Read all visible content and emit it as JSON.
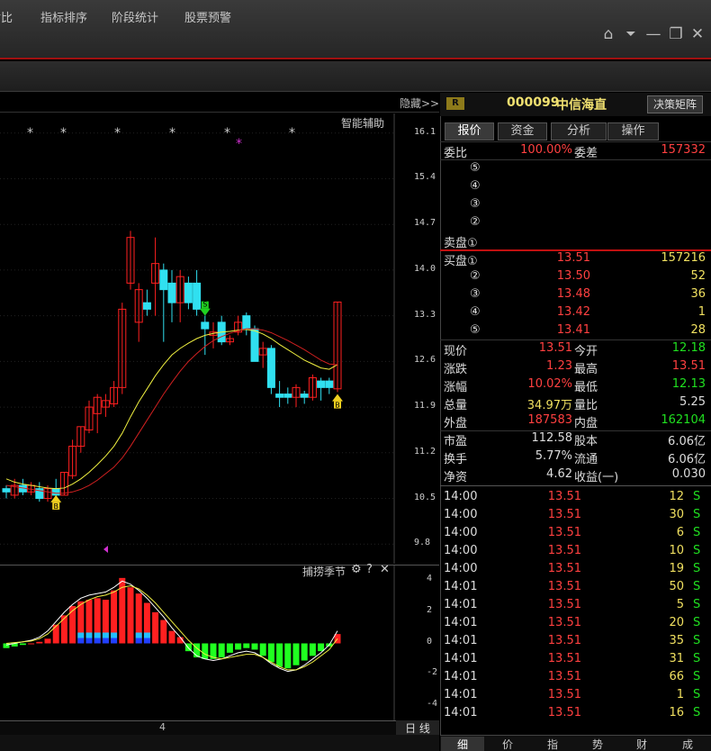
{
  "window_controls": {
    "home": "⌂",
    "dropdown": "⏷",
    "minimize": "—",
    "restore": "❐",
    "close": "✕"
  },
  "menu": [
    "对比",
    "指标排序",
    "阶段统计",
    "股票预警"
  ],
  "chart": {
    "hide_label": "隐藏>>",
    "assist_label": "智能辅助",
    "y_labels": [
      "16.1",
      "15.4",
      "14.7",
      "14.0",
      "13.3",
      "12.6",
      "11.9",
      "11.2",
      "10.5",
      "9.8"
    ],
    "sub_label": "捕捞季节",
    "sub_icons": {
      "gear": "⚙",
      "help": "?",
      "close": "✕"
    },
    "sub_y_labels": [
      "4",
      "2",
      "0",
      "-2",
      "-4"
    ],
    "x_label": "4",
    "period_button": "日 线",
    "buy_marker": "B",
    "sell_marker": "S"
  },
  "chart_data": {
    "type": "candlestick",
    "ylim": [
      9.5,
      16.4
    ],
    "candles": [
      {
        "o": 10.6,
        "h": 10.7,
        "l": 10.5,
        "c": 10.65,
        "up": false
      },
      {
        "o": 10.55,
        "h": 10.8,
        "l": 10.5,
        "c": 10.7,
        "up": true
      },
      {
        "o": 10.7,
        "h": 10.8,
        "l": 10.55,
        "c": 10.6,
        "up": false
      },
      {
        "o": 10.6,
        "h": 10.75,
        "l": 10.55,
        "c": 10.7,
        "up": true
      },
      {
        "o": 10.65,
        "h": 10.75,
        "l": 10.45,
        "c": 10.5,
        "up": false
      },
      {
        "o": 10.5,
        "h": 10.7,
        "l": 10.45,
        "c": 10.65,
        "up": true
      },
      {
        "o": 10.65,
        "h": 10.8,
        "l": 10.5,
        "c": 10.55,
        "up": false
      },
      {
        "o": 10.55,
        "h": 10.9,
        "l": 10.55,
        "c": 10.9,
        "up": true
      },
      {
        "o": 10.85,
        "h": 11.4,
        "l": 10.8,
        "c": 11.3,
        "up": true
      },
      {
        "o": 11.3,
        "h": 11.6,
        "l": 11.2,
        "c": 11.6,
        "up": true
      },
      {
        "o": 11.55,
        "h": 12.0,
        "l": 11.5,
        "c": 11.9,
        "up": true
      },
      {
        "o": 11.8,
        "h": 12.1,
        "l": 11.5,
        "c": 12.05,
        "up": true
      },
      {
        "o": 11.9,
        "h": 12.1,
        "l": 11.75,
        "c": 12.0,
        "up": true
      },
      {
        "o": 11.95,
        "h": 12.3,
        "l": 11.9,
        "c": 12.2,
        "up": true
      },
      {
        "o": 12.2,
        "h": 13.5,
        "l": 12.1,
        "c": 13.4,
        "up": true
      },
      {
        "o": 13.8,
        "h": 14.6,
        "l": 13.7,
        "c": 14.5,
        "up": true
      },
      {
        "o": 13.2,
        "h": 13.8,
        "l": 12.9,
        "c": 13.7,
        "up": true
      },
      {
        "o": 13.5,
        "h": 13.7,
        "l": 13.3,
        "c": 13.4,
        "up": false
      },
      {
        "o": 13.8,
        "h": 14.5,
        "l": 13.3,
        "c": 14.1,
        "up": true
      },
      {
        "o": 14.0,
        "h": 14.1,
        "l": 12.9,
        "c": 13.7,
        "up": false
      },
      {
        "o": 13.8,
        "h": 14.0,
        "l": 13.2,
        "c": 13.5,
        "up": false
      },
      {
        "o": 13.9,
        "h": 14.0,
        "l": 13.2,
        "c": 13.5,
        "up": true
      },
      {
        "o": 13.8,
        "h": 13.9,
        "l": 13.4,
        "c": 13.5,
        "up": false
      },
      {
        "o": 13.8,
        "h": 14.0,
        "l": 13.3,
        "c": 13.4,
        "up": false
      },
      {
        "o": 13.2,
        "h": 13.3,
        "l": 12.7,
        "c": 13.1,
        "up": false
      },
      {
        "o": 13.0,
        "h": 13.2,
        "l": 12.8,
        "c": 13.05,
        "up": true
      },
      {
        "o": 13.2,
        "h": 13.3,
        "l": 12.85,
        "c": 12.9,
        "up": false
      },
      {
        "o": 12.9,
        "h": 13.0,
        "l": 12.85,
        "c": 12.95,
        "up": true
      },
      {
        "o": 13.05,
        "h": 13.3,
        "l": 13.0,
        "c": 13.2,
        "up": true
      },
      {
        "o": 13.3,
        "h": 13.35,
        "l": 13.0,
        "c": 13.1,
        "up": false
      },
      {
        "o": 13.1,
        "h": 13.15,
        "l": 12.6,
        "c": 12.6,
        "up": false
      },
      {
        "o": 12.7,
        "h": 12.9,
        "l": 12.5,
        "c": 12.8,
        "up": true
      },
      {
        "o": 12.8,
        "h": 12.85,
        "l": 12.1,
        "c": 12.2,
        "up": false
      },
      {
        "o": 12.1,
        "h": 12.3,
        "l": 11.9,
        "c": 12.05,
        "up": false
      },
      {
        "o": 12.1,
        "h": 12.2,
        "l": 11.95,
        "c": 12.05,
        "up": false
      },
      {
        "o": 12.05,
        "h": 12.25,
        "l": 11.9,
        "c": 12.2,
        "up": true
      },
      {
        "o": 12.1,
        "h": 12.15,
        "l": 11.95,
        "c": 12.05,
        "up": false
      },
      {
        "o": 12.05,
        "h": 12.4,
        "l": 12.0,
        "c": 12.35,
        "up": true
      },
      {
        "o": 12.3,
        "h": 12.35,
        "l": 12.0,
        "c": 12.2,
        "up": false
      },
      {
        "o": 12.2,
        "h": 12.35,
        "l": 12.1,
        "c": 12.3,
        "up": false
      },
      {
        "o": 12.18,
        "h": 13.51,
        "l": 12.13,
        "c": 13.51,
        "up": true
      }
    ],
    "ma_yellow": [
      10.8,
      10.75,
      10.72,
      10.7,
      10.68,
      10.66,
      10.65,
      10.66,
      10.72,
      10.8,
      10.9,
      11.02,
      11.15,
      11.3,
      11.5,
      11.75,
      11.98,
      12.18,
      12.38,
      12.55,
      12.7,
      12.8,
      12.88,
      12.95,
      13.0,
      13.03,
      13.05,
      13.06,
      13.08,
      13.09,
      13.07,
      13.02,
      12.95,
      12.86,
      12.78,
      12.7,
      12.62,
      12.56,
      12.5,
      12.48,
      12.55
    ],
    "ma_red": [
      10.7,
      10.68,
      10.66,
      10.64,
      10.62,
      10.6,
      10.58,
      10.58,
      10.6,
      10.64,
      10.7,
      10.78,
      10.88,
      10.98,
      11.12,
      11.3,
      11.5,
      11.7,
      11.9,
      12.1,
      12.28,
      12.45,
      12.6,
      12.72,
      12.83,
      12.92,
      12.98,
      13.03,
      13.07,
      13.1,
      13.1,
      13.08,
      13.04,
      12.98,
      12.92,
      12.85,
      12.78,
      12.7,
      12.62,
      12.56,
      12.55
    ],
    "macd_hist": [
      -0.3,
      -0.2,
      -0.1,
      0,
      0.1,
      0.3,
      1.2,
      1.8,
      2.4,
      2.7,
      2.8,
      2.9,
      2.8,
      3.4,
      4.2,
      3.6,
      3.2,
      2.6,
      2.0,
      1.5,
      0.8,
      0.4,
      -0.5,
      -0.9,
      -1.0,
      -1.0,
      -0.9,
      -0.6,
      -0.4,
      -0.3,
      -0.4,
      -0.8,
      -1.2,
      -1.5,
      -1.6,
      -1.4,
      -1.1,
      -0.8,
      -0.5,
      -0.2,
      0.6
    ],
    "macd_dif": [
      -0.1,
      0,
      0.1,
      0.2,
      0.4,
      0.8,
      1.4,
      2.0,
      2.5,
      2.9,
      3.1,
      3.2,
      3.3,
      3.6,
      4.0,
      3.8,
      3.4,
      2.9,
      2.3,
      1.7,
      1.0,
      0.4,
      -0.3,
      -0.8,
      -1.0,
      -1.1,
      -1.0,
      -0.8,
      -0.6,
      -0.5,
      -0.6,
      -0.9,
      -1.3,
      -1.6,
      -1.8,
      -1.7,
      -1.4,
      -1.0,
      -0.6,
      -0.1,
      0.8
    ],
    "macd_dea": [
      0,
      0.05,
      0.1,
      0.15,
      0.3,
      0.6,
      1.1,
      1.6,
      2.1,
      2.5,
      2.8,
      3.0,
      3.1,
      3.3,
      3.6,
      3.7,
      3.5,
      3.1,
      2.6,
      2.0,
      1.4,
      0.8,
      0.2,
      -0.3,
      -0.7,
      -0.9,
      -1.0,
      -0.9,
      -0.8,
      -0.7,
      -0.7,
      -0.9,
      -1.2,
      -1.5,
      -1.7,
      -1.7,
      -1.5,
      -1.2,
      -0.8,
      -0.4,
      0.3
    ],
    "sublim": [
      -5,
      5
    ]
  },
  "stock": {
    "badge": "R",
    "code": "000099",
    "name": "中信海直",
    "decision_button": "决策矩阵"
  },
  "tabs": [
    "报价",
    "资金",
    "分析",
    "操作"
  ],
  "order_book": {
    "wei_bi_label": "委比",
    "wei_bi": "100.00%",
    "wei_cha_label": "委差",
    "wei_cha": "157332",
    "sell_labels": [
      "⑤",
      "④",
      "③",
      "②",
      "卖盘①"
    ],
    "buy": [
      {
        "label": "买盘①",
        "price": "13.51",
        "vol": "157216"
      },
      {
        "label": "②",
        "price": "13.50",
        "vol": "52"
      },
      {
        "label": "③",
        "price": "13.48",
        "vol": "36"
      },
      {
        "label": "④",
        "price": "13.42",
        "vol": "1"
      },
      {
        "label": "⑤",
        "price": "13.41",
        "vol": "28"
      }
    ]
  },
  "quote": [
    {
      "l1": "现价",
      "v1": "13.51",
      "c1": "red",
      "l2": "今开",
      "v2": "12.18",
      "c2": "green"
    },
    {
      "l1": "涨跌",
      "v1": "1.23",
      "c1": "red",
      "l2": "最高",
      "v2": "13.51",
      "c2": "red"
    },
    {
      "l1": "涨幅",
      "v1": "10.02%",
      "c1": "red",
      "l2": "最低",
      "v2": "12.13",
      "c2": "green"
    },
    {
      "l1": "总量",
      "v1": "34.97万",
      "c1": "yellow",
      "l2": "量比",
      "v2": "5.25",
      "c2": "white"
    },
    {
      "l1": "外盘",
      "v1": "187583",
      "c1": "red",
      "l2": "内盘",
      "v2": "162104",
      "c2": "green"
    },
    {
      "l1": "市盈",
      "v1": "112.58",
      "c1": "white",
      "l2": "股本",
      "v2": "6.06亿",
      "c2": "white"
    },
    {
      "l1": "换手",
      "v1": "5.77%",
      "c1": "white",
      "l2": "流通",
      "v2": "6.06亿",
      "c2": "white"
    },
    {
      "l1": "净资",
      "v1": "4.62",
      "c1": "white",
      "l2": "收益(一)",
      "v2": "0.030",
      "c2": "white"
    }
  ],
  "ticks": [
    {
      "t": "14:00",
      "p": "13.51",
      "v": "12",
      "s": "S"
    },
    {
      "t": "14:00",
      "p": "13.51",
      "v": "30",
      "s": "S"
    },
    {
      "t": "14:00",
      "p": "13.51",
      "v": "6",
      "s": "S"
    },
    {
      "t": "14:00",
      "p": "13.51",
      "v": "10",
      "s": "S"
    },
    {
      "t": "14:00",
      "p": "13.51",
      "v": "19",
      "s": "S"
    },
    {
      "t": "14:01",
      "p": "13.51",
      "v": "50",
      "s": "S"
    },
    {
      "t": "14:01",
      "p": "13.51",
      "v": "5",
      "s": "S"
    },
    {
      "t": "14:01",
      "p": "13.51",
      "v": "20",
      "s": "S"
    },
    {
      "t": "14:01",
      "p": "13.51",
      "v": "35",
      "s": "S"
    },
    {
      "t": "14:01",
      "p": "13.51",
      "v": "31",
      "s": "S"
    },
    {
      "t": "14:01",
      "p": "13.51",
      "v": "66",
      "s": "S"
    },
    {
      "t": "14:01",
      "p": "13.51",
      "v": "1",
      "s": "S"
    },
    {
      "t": "14:01",
      "p": "13.51",
      "v": "16",
      "s": "S"
    }
  ],
  "bottom_tabs": [
    "细",
    "价",
    "指",
    "势",
    "财",
    "成"
  ]
}
